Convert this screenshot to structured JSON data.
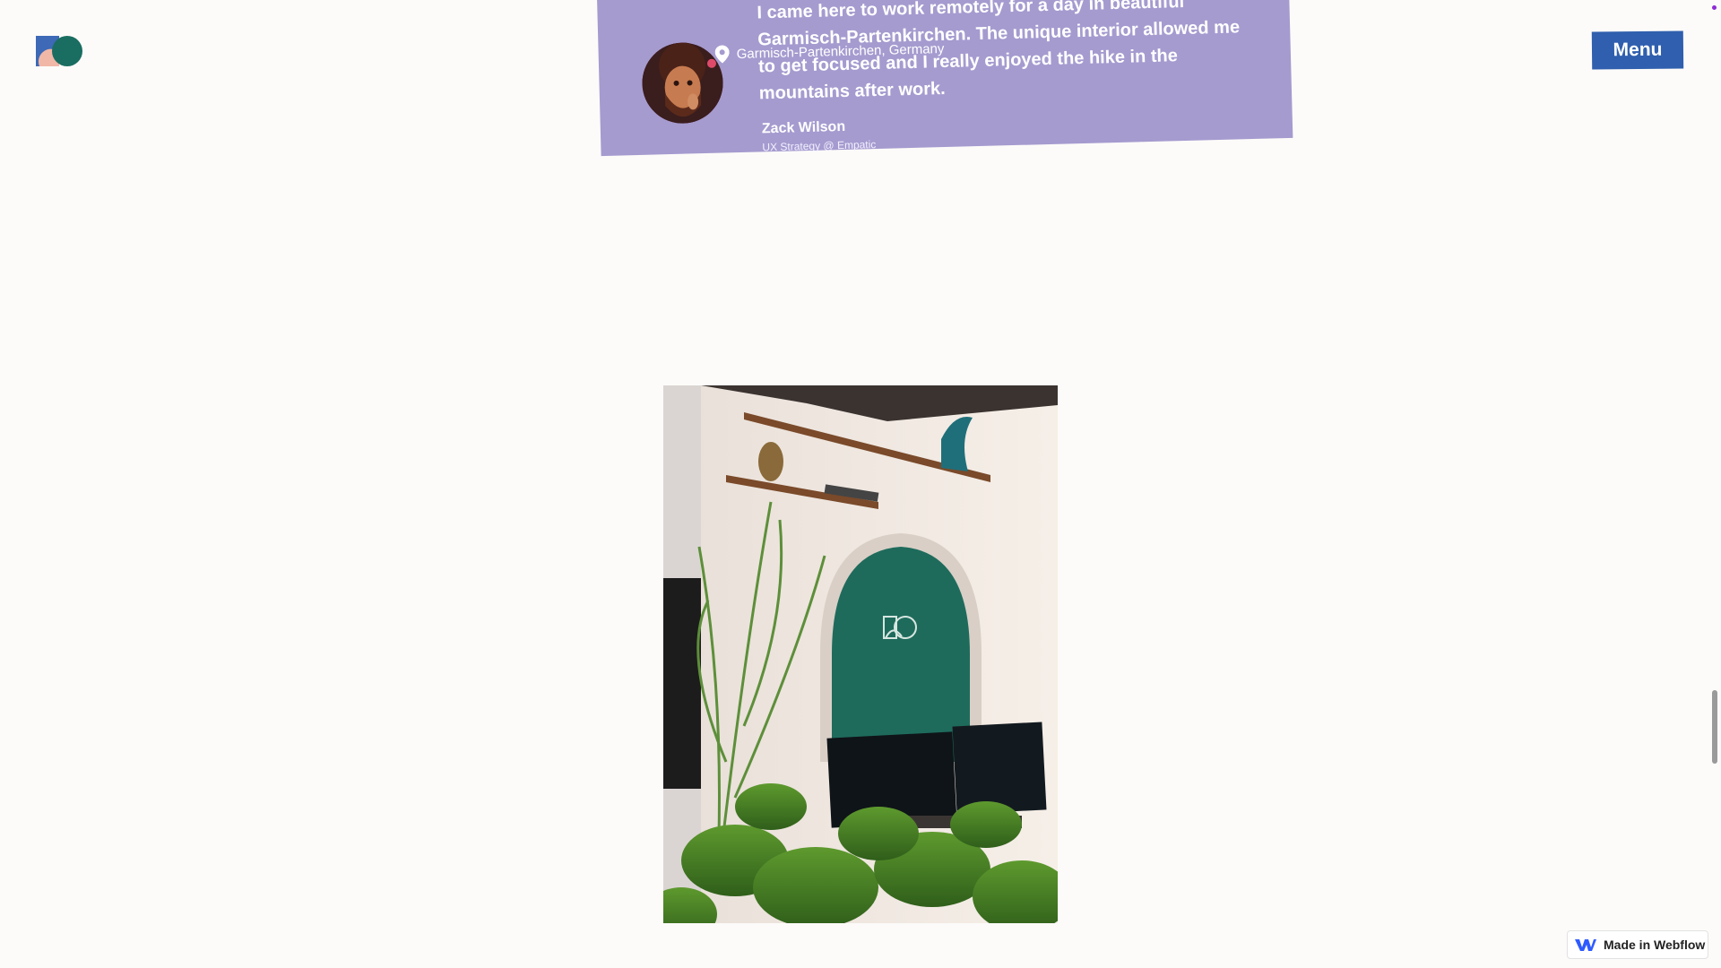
{
  "header": {
    "logo_name": "brand-logo",
    "menu_label": "Menu"
  },
  "testimonial": {
    "location": "Garmisch-Partenkirchen, Germany",
    "quote": "I came here to work remotely for a day in beautiful Garmisch-Partenkirchen. The unique interior allowed me to get focused and I really enjoyed the hike in the mountains after work.",
    "author": "Zack Wilson",
    "role": "UX Strategy @ Empatic",
    "background": "#a59bcf"
  },
  "badge": {
    "label": "Made in Webflow"
  },
  "colors": {
    "menu_button": "#2f5fae",
    "page_background": "#fcfbf9",
    "arch_green": "#1e6b5c"
  }
}
